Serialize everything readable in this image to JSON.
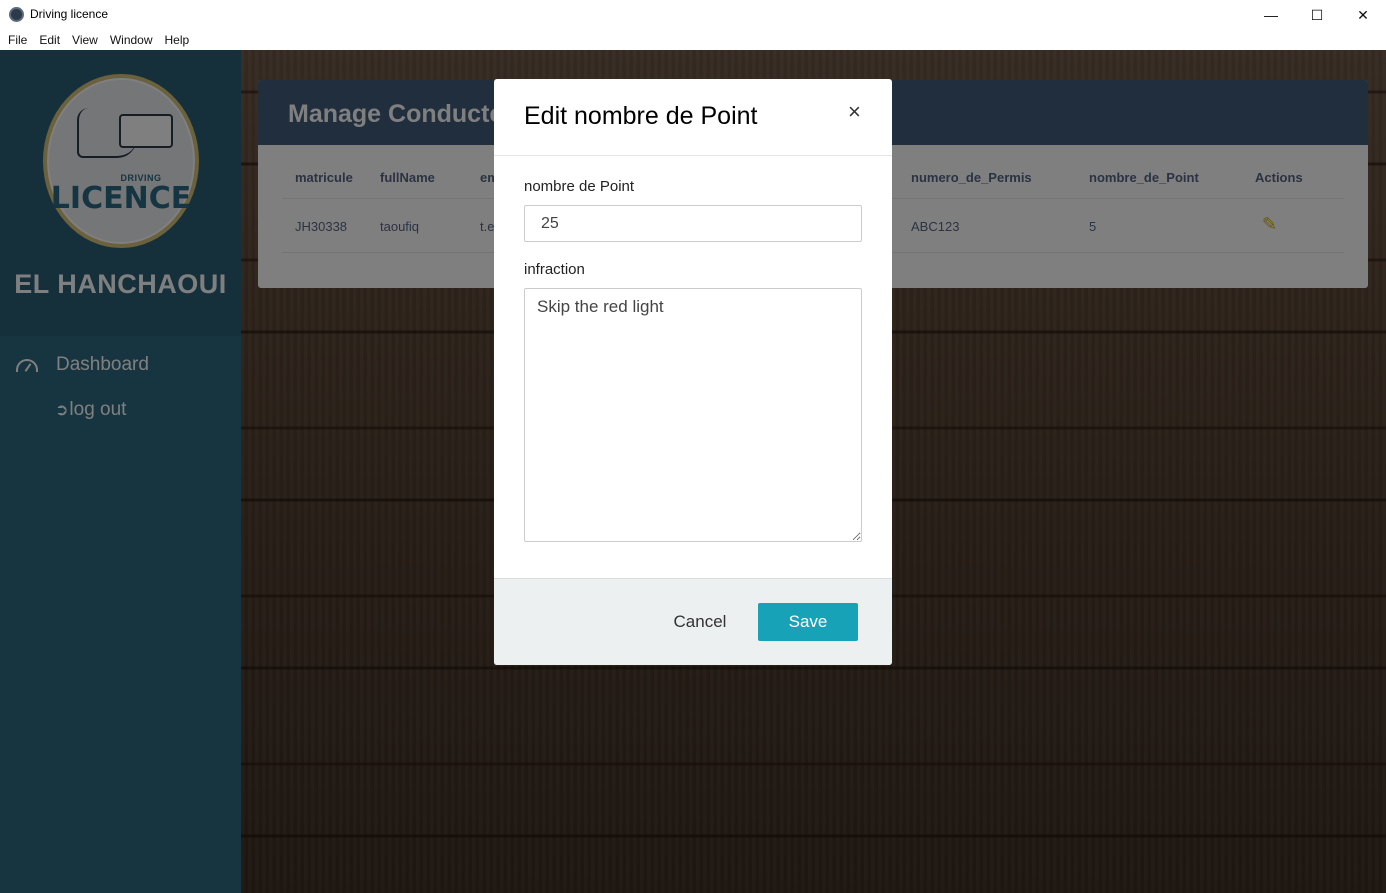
{
  "window": {
    "title": "Driving licence",
    "controls": {
      "minimize": "—",
      "maximize": "☐",
      "close": "✕"
    }
  },
  "menu": [
    "File",
    "Edit",
    "View",
    "Window",
    "Help"
  ],
  "sidebar": {
    "logo": {
      "small_text": "DRIVING",
      "big_text": "LICENCE"
    },
    "user_name": "EL HANCHAOUI",
    "nav": [
      {
        "label": "Dashboard",
        "icon": "gauge-icon"
      },
      {
        "label": "log out",
        "icon": "sign-out-icon"
      }
    ]
  },
  "card": {
    "title": "Manage Conducteurs",
    "columns": [
      "matricule",
      "fullName",
      "email",
      "numero_de_Permis",
      "nombre_de_Point",
      "Actions"
    ],
    "rows": [
      {
        "matricule": "JH30338",
        "fullName": "taoufiq",
        "email": "t.e",
        "numero_de_Permis": "ABC123",
        "nombre_de_Point": "5"
      }
    ]
  },
  "modal": {
    "title": "Edit nombre de Point",
    "close": "×",
    "points_label": "nombre de Point",
    "points_value": "25",
    "infraction_label": "infraction",
    "infraction_value": "Skip the red light",
    "cancel_label": "Cancel",
    "save_label": "Save"
  },
  "colors": {
    "sidebar": "#2f6b82",
    "card_header": "#435d7d",
    "save_button": "#17a2b8",
    "edit_icon": "#d4b106"
  }
}
